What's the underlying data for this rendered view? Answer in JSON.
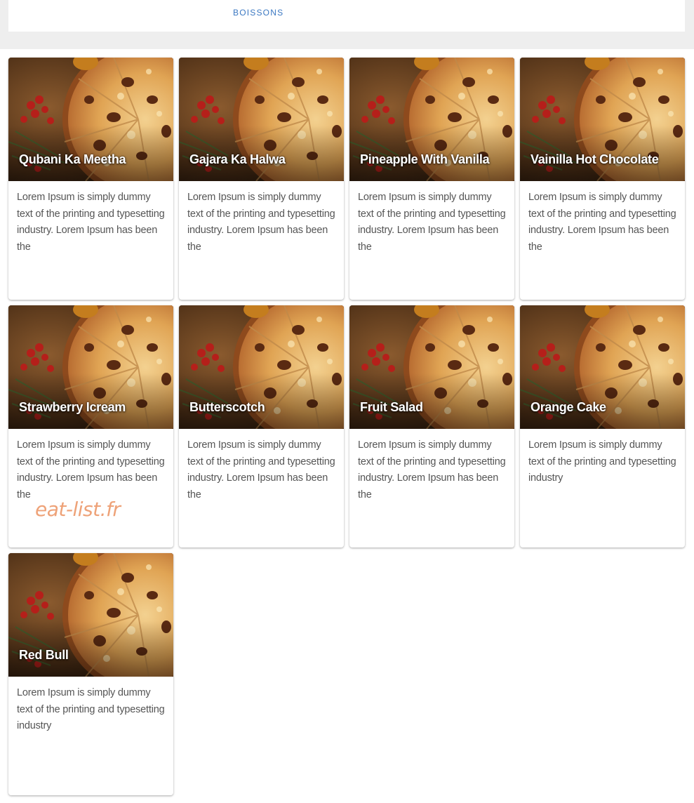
{
  "nav": {
    "active_tab": "BOISSONS"
  },
  "colors": {
    "tab_accent": "#3b78c2",
    "page_background": "#eeeeee",
    "watermark": "#eea278"
  },
  "cards": [
    {
      "title": "Qubani Ka Meetha",
      "description": "Lorem Ipsum is simply dummy text of the printing and typesetting industry. Lorem Ipsum has been the"
    },
    {
      "title": "Gajara Ka Halwa",
      "description": "Lorem Ipsum is simply dummy text of the printing and typesetting industry. Lorem Ipsum has been the"
    },
    {
      "title": "Pineapple With Vanilla",
      "description": "Lorem Ipsum is simply dummy text of the printing and typesetting industry. Lorem Ipsum has been the"
    },
    {
      "title": "Vainilla Hot Chocolate",
      "description": "Lorem Ipsum is simply dummy text of the printing and typesetting industry. Lorem Ipsum has been the"
    },
    {
      "title": "Strawberry Icream",
      "description": "Lorem Ipsum is simply dummy text of the printing and typesetting industry. Lorem Ipsum has been the"
    },
    {
      "title": "Butterscotch",
      "description": "Lorem Ipsum is simply dummy text of the printing and typesetting industry. Lorem Ipsum has been the"
    },
    {
      "title": "Fruit Salad",
      "description": "Lorem Ipsum is simply dummy text of the printing and typesetting industry. Lorem Ipsum has been the"
    },
    {
      "title": "Orange Cake",
      "description": "Lorem Ipsum is simply dummy text of the printing and typesetting industry"
    },
    {
      "title": "Red Bull",
      "description": "Lorem Ipsum is simply dummy text of the printing and typesetting industry"
    }
  ],
  "watermark": {
    "text": "eat-list.fr"
  }
}
